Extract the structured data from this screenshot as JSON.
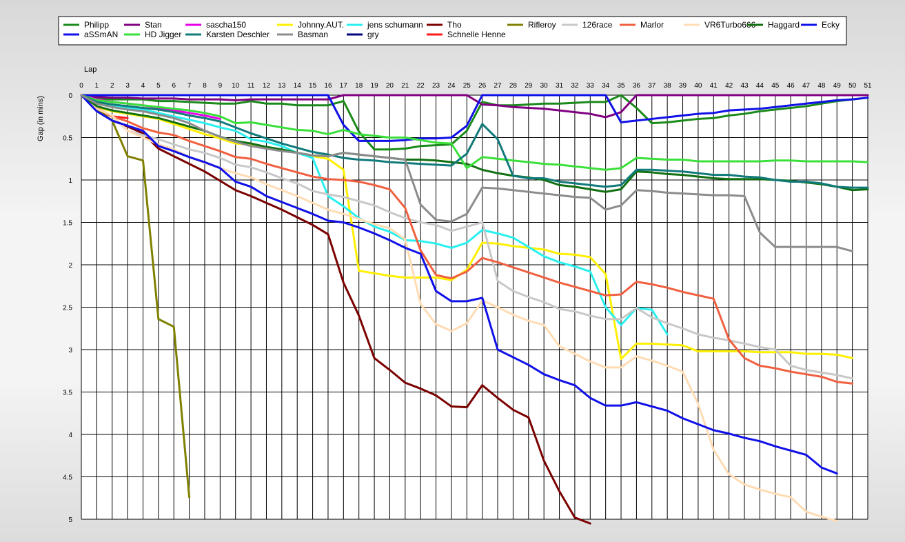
{
  "chart_data": {
    "type": "line",
    "xlabel": "Lap",
    "ylabel": "Gap (in mins)",
    "xlim": [
      0,
      51
    ],
    "ylim": [
      0,
      5
    ],
    "y_inverted": true,
    "grid": true,
    "legend_position": "top",
    "x_ticks": [
      0,
      1,
      2,
      3,
      4,
      5,
      6,
      7,
      8,
      9,
      10,
      11,
      12,
      13,
      14,
      15,
      16,
      17,
      18,
      19,
      20,
      21,
      22,
      23,
      24,
      25,
      26,
      27,
      28,
      29,
      30,
      31,
      32,
      33,
      34,
      35,
      36,
      37,
      38,
      39,
      40,
      41,
      42,
      43,
      44,
      45,
      46,
      47,
      48,
      49,
      50,
      51
    ],
    "y_ticks": [
      0,
      0.5,
      1,
      1.5,
      2,
      2.5,
      3,
      3.5,
      4,
      4.5,
      5
    ],
    "y_tick_labels": [
      "0",
      "0.5",
      "1",
      "1.5",
      "2",
      "2.5",
      "3",
      "3.5",
      "4",
      "4.5",
      "5"
    ],
    "series": [
      {
        "name": "Philipp",
        "color": "#1a8a1a",
        "values": [
          0,
          0.04,
          0.05,
          0.05,
          0.05,
          0.07,
          0.07,
          0.08,
          0.09,
          0.1,
          0.1,
          0.07,
          0.1,
          0.1,
          0.12,
          0.12,
          0.12,
          0.07,
          0.43,
          0.64,
          0.64,
          0.63,
          0.6,
          0.59,
          0.58,
          0.42,
          0.08,
          0.12,
          0.12,
          0.11,
          0.1,
          0.1,
          0.09,
          0.08,
          0.08,
          0,
          0.15,
          0.33,
          0.32,
          0.3,
          0.28,
          0.27,
          0.24,
          0.22,
          0.19,
          0.17,
          0.15,
          0.13,
          0.1,
          0.07,
          0.05,
          0.03
        ]
      },
      {
        "name": "Stan",
        "color": "#800080",
        "values": [
          0,
          0.02,
          0.03,
          0.03,
          0.04,
          0.04,
          0.04,
          0.05,
          0.05,
          0.05,
          0.06,
          0.05,
          0.05,
          0.05,
          0.05,
          0.05,
          0.05,
          0,
          0,
          0,
          0,
          0,
          0,
          0,
          0,
          0,
          0.11,
          0.12,
          0.14,
          0.15,
          0.16,
          0.18,
          0.2,
          0.22,
          0.26,
          0.2,
          0,
          0,
          0,
          0,
          0,
          0,
          0,
          0,
          0,
          0,
          0,
          0,
          0,
          0,
          0,
          0
        ]
      },
      {
        "name": "sascha150",
        "color": "#e800e8",
        "values": [
          0,
          0.05,
          0.08,
          0.1,
          0.12,
          0.15,
          0.18,
          0.21,
          0.24,
          0.28
        ]
      },
      {
        "name": "Johnny.AUT.",
        "color": "#ffef00",
        "values": [
          0,
          0.14,
          0.19,
          0.22,
          0.25,
          0.28,
          0.34,
          0.4,
          0.46,
          0.51,
          0.57,
          0.58,
          0.62,
          0.65,
          0.68,
          0.72,
          0.75,
          0.88,
          2.07,
          2.1,
          2.13,
          2.15,
          2.15,
          2.15,
          2.18,
          2.06,
          1.74,
          1.75,
          1.78,
          1.8,
          1.82,
          1.87,
          1.88,
          1.91,
          2.11,
          3.11,
          2.93,
          2.93,
          2.94,
          2.95,
          3.02,
          3.02,
          3.02,
          3.02,
          3.03,
          3.03,
          3.03,
          3.05,
          3.05,
          3.06,
          3.1
        ]
      },
      {
        "name": "jens schumann",
        "color": "#29f0f0",
        "values": [
          0,
          0.1,
          0.13,
          0.15,
          0.17,
          0.21,
          0.25,
          0.29,
          0.33,
          0.38,
          0.42,
          0.52,
          0.55,
          0.6,
          0.68,
          0.74,
          1.19,
          1.31,
          1.45,
          1.55,
          1.61,
          1.71,
          1.72,
          1.75,
          1.8,
          1.74,
          1.59,
          1.63,
          1.68,
          1.79,
          1.9,
          1.97,
          2.02,
          2.08,
          2.5,
          2.71,
          2.51,
          2.53,
          2.82
        ]
      },
      {
        "name": "Tho",
        "color": "#7a0000",
        "values": [
          0,
          0.17,
          0.3,
          0.37,
          0.45,
          0.63,
          0.72,
          0.81,
          0.9,
          1.01,
          1.12,
          1.19,
          1.27,
          1.35,
          1.44,
          1.53,
          1.64,
          2.21,
          2.6,
          3.1,
          3.24,
          3.39,
          3.46,
          3.54,
          3.67,
          3.68,
          3.42,
          3.57,
          3.71,
          3.8,
          4.31,
          4.67,
          4.98,
          5.05
        ]
      },
      {
        "name": "Schnelle Henne",
        "color": "#ff1a1a",
        "values": [
          0,
          0.17,
          0.25,
          0.27
        ]
      },
      {
        "name": "Rifleroy",
        "color": "#808000",
        "values": [
          0,
          0.16,
          0.3,
          0.72,
          0.77,
          2.64,
          2.73,
          4.74
        ]
      },
      {
        "name": "126race",
        "color": "#c8c8c8",
        "values": [
          0,
          0.15,
          0.25,
          0.42,
          0.47,
          0.52,
          0.58,
          0.64,
          0.68,
          0.74,
          0.82,
          0.85,
          0.91,
          0.98,
          1.04,
          1.13,
          1.17,
          1.2,
          1.25,
          1.3,
          1.38,
          1.45,
          1.5,
          1.53,
          1.6,
          1.55,
          1.5,
          2.19,
          2.31,
          2.38,
          2.44,
          2.52,
          2.55,
          2.6,
          2.64,
          2.64,
          2.51,
          2.62,
          2.69,
          2.75,
          2.82,
          2.86,
          2.89,
          2.93,
          2.97,
          3.0,
          3.19,
          3.24,
          3.27,
          3.3,
          3.34
        ]
      },
      {
        "name": "Marlor",
        "color": "#f06040",
        "values": [
          0,
          0.15,
          0.25,
          0.31,
          0.39,
          0.44,
          0.47,
          0.54,
          0.6,
          0.66,
          0.73,
          0.75,
          0.81,
          0.86,
          0.91,
          0.96,
          0.99,
          1.0,
          1.02,
          1.06,
          1.11,
          1.33,
          1.83,
          2.12,
          2.16,
          2.08,
          1.92,
          1.97,
          2.03,
          2.09,
          2.15,
          2.21,
          2.26,
          2.31,
          2.36,
          2.35,
          2.2,
          2.23,
          2.27,
          2.32,
          2.36,
          2.4,
          2.88,
          3.1,
          3.19,
          3.22,
          3.26,
          3.29,
          3.32,
          3.38,
          3.4
        ]
      },
      {
        "name": "VR6Turbo666",
        "color": "#ffdcb4",
        "values": [
          0,
          0.16,
          0.24,
          0.42,
          0.5,
          0.58,
          0.64,
          0.73,
          0.8,
          0.86,
          0.92,
          0.97,
          1.05,
          1.12,
          1.19,
          1.27,
          1.35,
          1.4,
          1.46,
          1.52,
          1.57,
          1.7,
          2.46,
          2.7,
          2.78,
          2.69,
          2.42,
          2.5,
          2.59,
          2.66,
          2.71,
          2.96,
          3.05,
          3.14,
          3.21,
          3.21,
          3.08,
          3.13,
          3.19,
          3.26,
          3.64,
          4.18,
          4.47,
          4.59,
          4.65,
          4.7,
          4.74,
          4.91,
          4.97,
          5.02
        ]
      },
      {
        "name": "Haggard",
        "color": "#127012",
        "values": [
          0,
          0.13,
          0.18,
          0.21,
          0.24,
          0.27,
          0.32,
          0.37,
          0.42,
          0.49,
          0.54,
          0.57,
          0.61,
          0.64,
          0.68,
          0.71,
          0.72,
          0.68,
          0.7,
          0.72,
          0.74,
          0.76,
          0.76,
          0.77,
          0.79,
          0.81,
          0.88,
          0.92,
          0.95,
          0.97,
          1.0,
          1.06,
          1.08,
          1.11,
          1.14,
          1.11,
          0.9,
          0.91,
          0.93,
          0.94,
          0.96,
          0.98,
          0.99,
          0.99,
          0.99,
          1.0,
          1.01,
          1.03,
          1.05,
          1.08,
          1.12,
          1.11
        ]
      },
      {
        "name": "Ecky",
        "color": "#1010e8",
        "values": [
          0,
          0,
          0,
          0,
          0,
          0,
          0,
          0,
          0,
          0,
          0,
          0,
          0,
          0,
          0,
          0,
          0,
          0.35,
          0.54,
          0.54,
          0.54,
          0.53,
          0.51,
          0.51,
          0.5,
          0.36,
          0,
          0,
          0,
          0,
          0,
          0,
          0,
          0,
          0,
          0.32,
          0.3,
          0.28,
          0.26,
          0.24,
          0.22,
          0.21,
          0.18,
          0.17,
          0.16,
          0.14,
          0.12,
          0.1,
          0.08,
          0.06,
          0.05,
          0.03
        ]
      },
      {
        "name": "aSSmAN",
        "color": "#1010e8",
        "values": [
          0,
          0.19,
          0.3,
          0.36,
          0.42,
          0.6,
          0.66,
          0.73,
          0.79,
          0.86,
          1.02,
          1.08,
          1.19,
          1.26,
          1.33,
          1.4,
          1.48,
          1.5,
          1.56,
          1.63,
          1.71,
          1.8,
          1.87,
          2.31,
          2.43,
          2.43,
          2.39,
          3.0,
          3.09,
          3.18,
          3.29,
          3.36,
          3.42,
          3.57,
          3.66,
          3.66,
          3.62,
          3.67,
          3.72,
          3.81,
          3.88,
          3.95,
          3.99,
          4.04,
          4.08,
          4.14,
          4.19,
          4.24,
          4.39,
          4.46
        ]
      },
      {
        "name": "HD Jigger",
        "color": "#3ae03a",
        "values": [
          0,
          0.06,
          0.08,
          0.1,
          0.12,
          0.14,
          0.16,
          0.18,
          0.21,
          0.25,
          0.33,
          0.32,
          0.35,
          0.38,
          0.41,
          0.42,
          0.46,
          0.41,
          0.46,
          0.48,
          0.5,
          0.5,
          0.53,
          0.56,
          0.57,
          0.86,
          0.73,
          0.75,
          0.77,
          0.79,
          0.81,
          0.82,
          0.84,
          0.86,
          0.88,
          0.86,
          0.74,
          0.75,
          0.76,
          0.76,
          0.78,
          0.78,
          0.78,
          0.78,
          0.78,
          0.77,
          0.77,
          0.78,
          0.78,
          0.78,
          0.78,
          0.79
        ]
      },
      {
        "name": "Karsten Deschler",
        "color": "#117a7a",
        "values": [
          0,
          0.08,
          0.11,
          0.13,
          0.15,
          0.17,
          0.2,
          0.24,
          0.27,
          0.31,
          0.38,
          0.45,
          0.51,
          0.57,
          0.62,
          0.67,
          0.7,
          0.74,
          0.76,
          0.77,
          0.79,
          0.8,
          0.81,
          0.82,
          0.83,
          0.69,
          0.34,
          0.52,
          0.95,
          0.98,
          0.98,
          1.02,
          1.04,
          1.06,
          1.08,
          1.06,
          0.88,
          0.88,
          0.89,
          0.9,
          0.92,
          0.94,
          0.94,
          0.96,
          0.97,
          1.0,
          1.02,
          1.02,
          1.04,
          1.08,
          1.09,
          1.09
        ]
      },
      {
        "name": "Basman",
        "color": "#8c8c8c",
        "values": [
          0,
          0.1,
          0.14,
          0.17,
          0.19,
          0.23,
          0.27,
          0.33,
          0.42,
          0.49,
          0.55,
          0.6,
          0.63,
          0.66,
          0.68,
          0.71,
          0.72,
          0.68,
          0.7,
          0.72,
          0.74,
          0.76,
          1.29,
          1.47,
          1.49,
          1.4,
          1.09,
          1.1,
          1.12,
          1.14,
          1.16,
          1.18,
          1.2,
          1.21,
          1.35,
          1.3,
          1.12,
          1.13,
          1.15,
          1.16,
          1.17,
          1.18,
          1.18,
          1.19,
          1.62,
          1.79,
          1.79,
          1.79,
          1.79,
          1.79,
          1.84
        ]
      },
      {
        "name": "gry",
        "color": "#000080",
        "values": [
          0
        ]
      }
    ]
  },
  "legend_rows": [
    [
      0,
      1,
      2,
      3,
      4,
      5,
      7,
      8,
      9,
      10,
      11,
      12
    ],
    [
      13,
      14,
      15,
      16,
      17,
      6
    ]
  ]
}
